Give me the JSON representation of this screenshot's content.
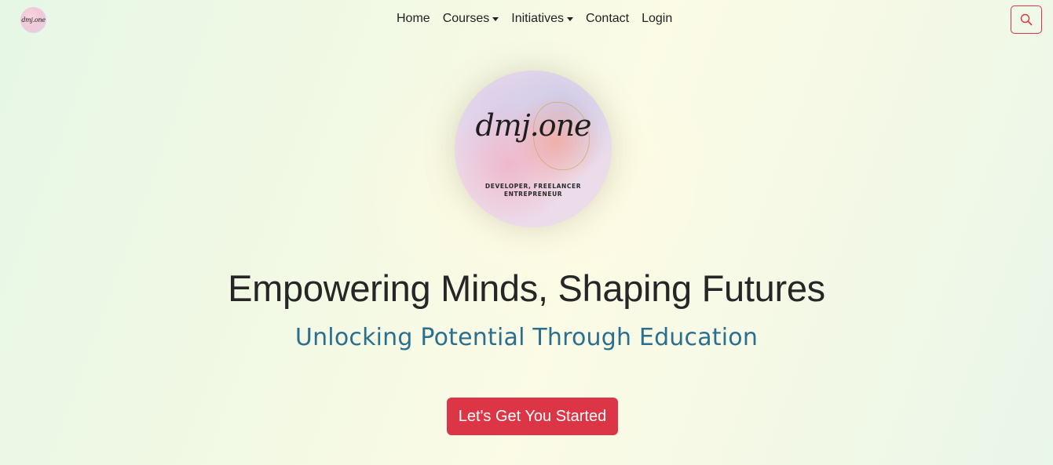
{
  "brand": {
    "logo_text": "dmj.one"
  },
  "nav": {
    "items": [
      {
        "label": "Home",
        "dropdown": false
      },
      {
        "label": "Courses",
        "dropdown": true
      },
      {
        "label": "Initiatives",
        "dropdown": true
      },
      {
        "label": "Contact",
        "dropdown": false
      },
      {
        "label": "Login",
        "dropdown": false
      }
    ],
    "search_icon": "search-icon"
  },
  "hero": {
    "logo_script": "dmj.one",
    "logo_tagline_1": "DEVELOPER, FREELANCER",
    "logo_tagline_2": "ENTREPRENEUR",
    "headline": "Empowering Minds, Shaping Futures",
    "subheadline": "Unlocking Potential Through Education",
    "cta_label": "Let's Get You Started"
  },
  "colors": {
    "accent": "#dc3545",
    "subheadline": "#2b6f8f",
    "headline": "#262626"
  }
}
